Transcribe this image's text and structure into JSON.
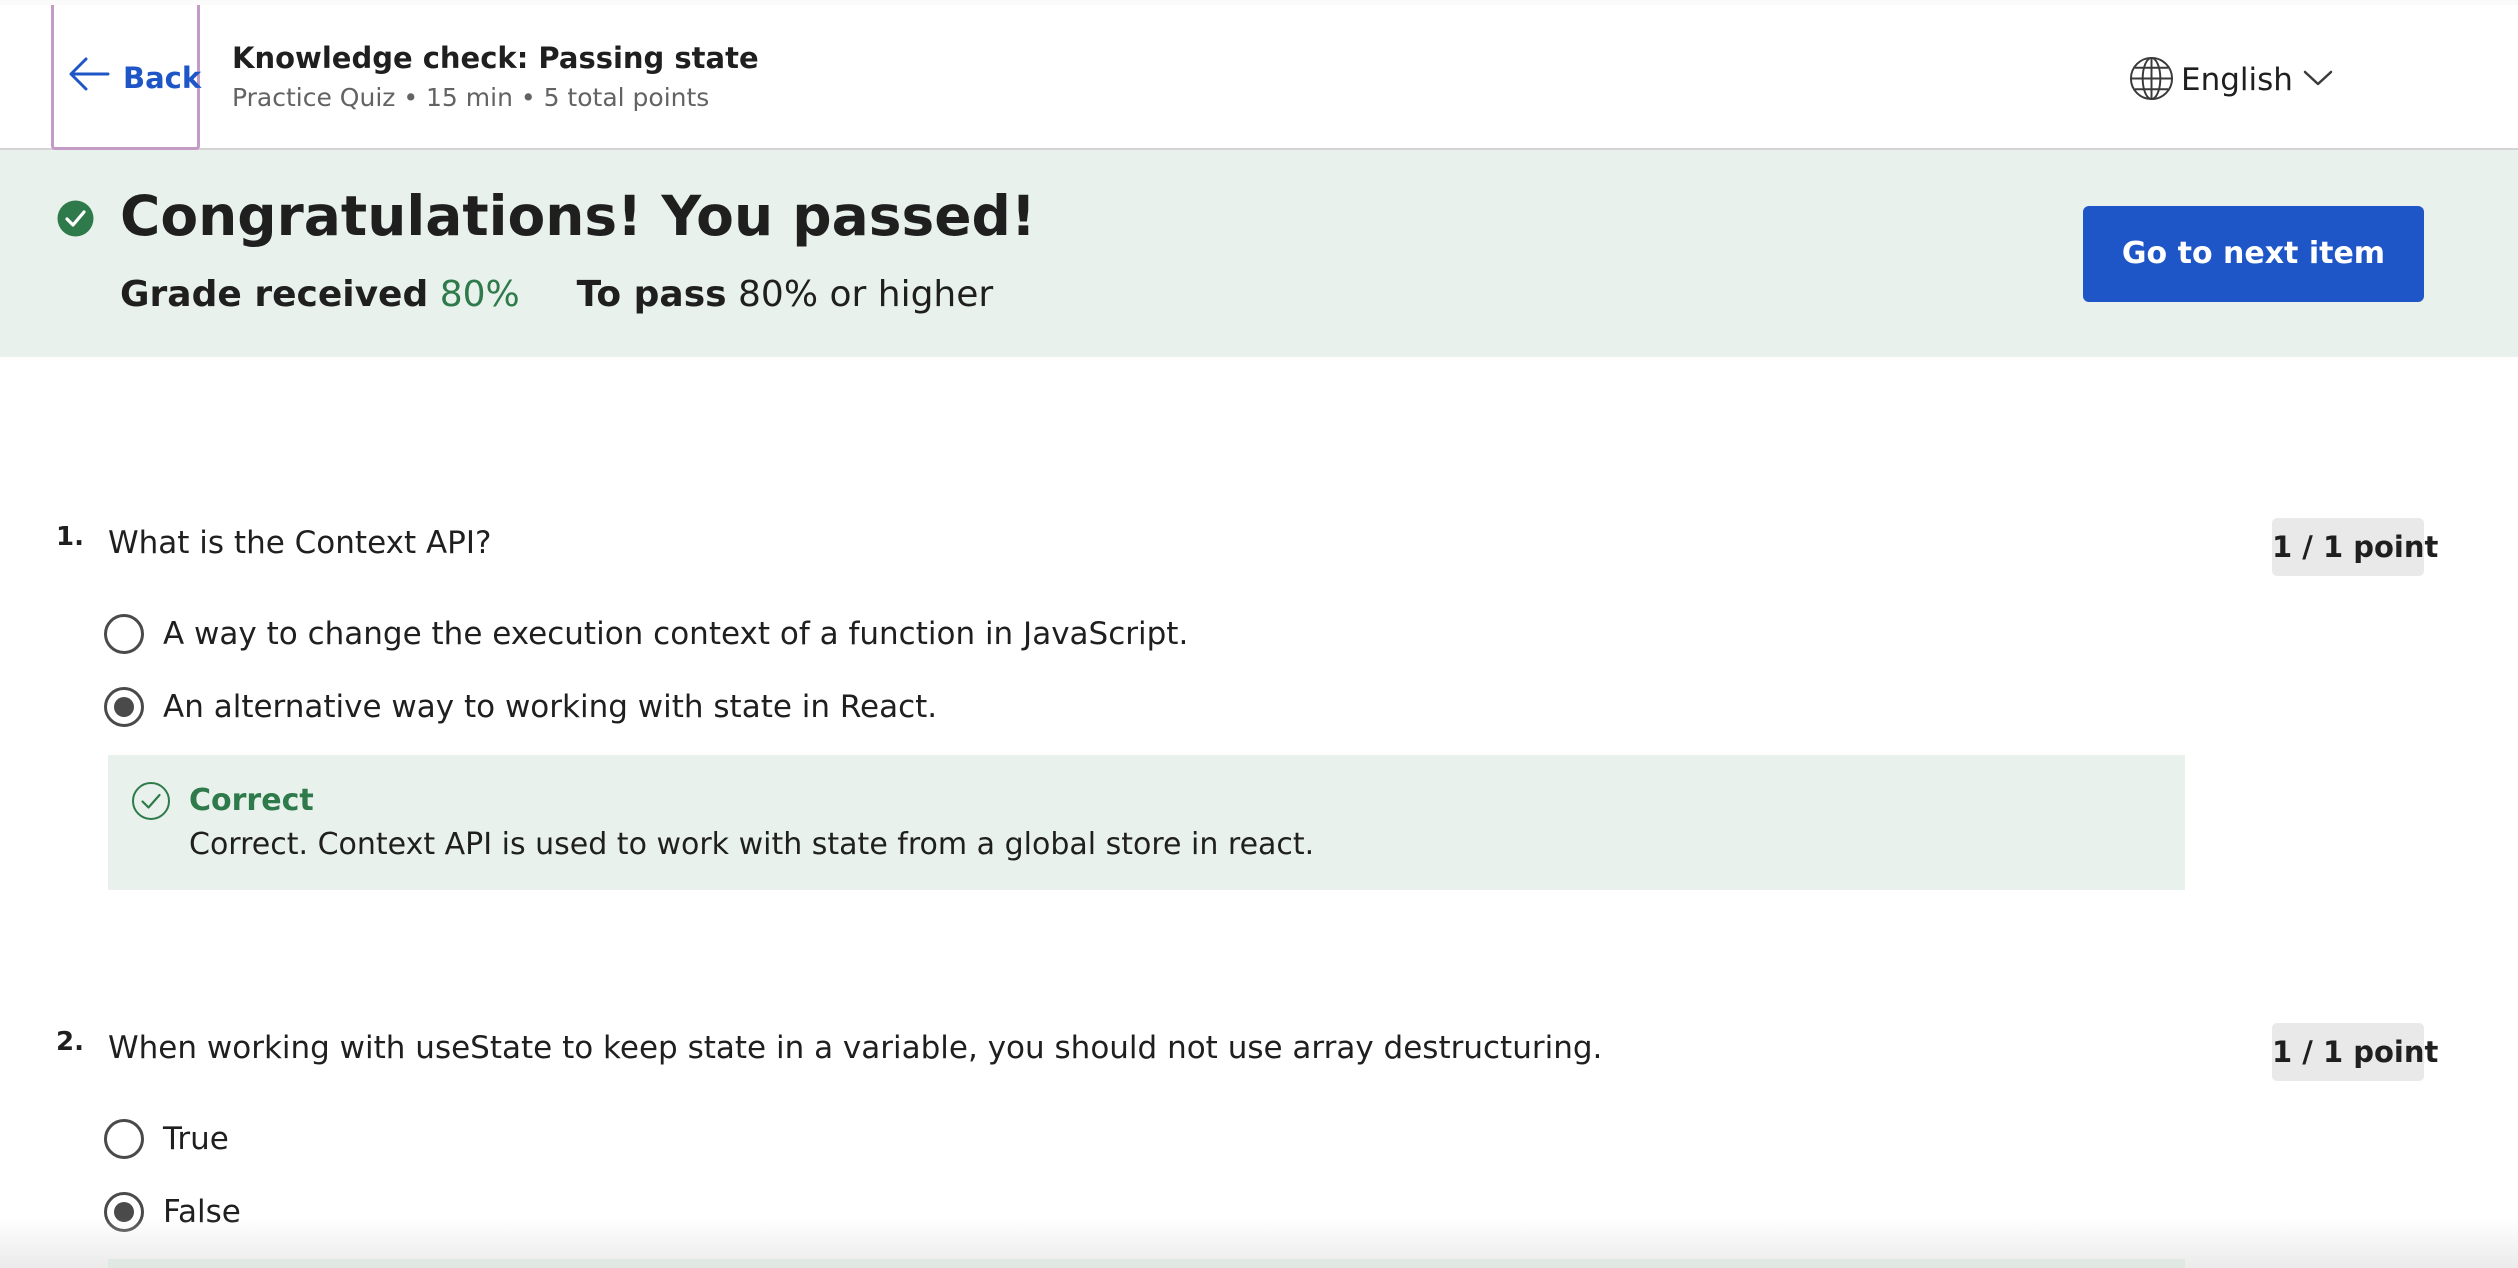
{
  "header": {
    "back_label": "Back",
    "title": "Knowledge check: Passing state",
    "meta": "Practice Quiz • 15 min • 5 total points",
    "language": "English"
  },
  "banner": {
    "title": "Congratulations! You passed!",
    "grade_label": "Grade received",
    "grade_value": "80%",
    "pass_label": "To pass",
    "pass_value": "80% or higher",
    "next_button": "Go to next item"
  },
  "questions": [
    {
      "number": "1.",
      "text": "What is the Context API?",
      "points": "1 / 1 point",
      "options": [
        {
          "label": "A way to change the execution context of a function in JavaScript.",
          "selected": false
        },
        {
          "label": "An alternative way to working with state in React.",
          "selected": true
        }
      ],
      "feedback": {
        "title": "Correct",
        "text": "Correct. Context API is used to work with state from a global store in react."
      }
    },
    {
      "number": "2.",
      "text": "When working with useState to keep state in a variable, you should not use array destructuring.",
      "points": "1 / 1 point",
      "options": [
        {
          "label": "True",
          "selected": false
        },
        {
          "label": "False",
          "selected": true
        }
      ]
    }
  ],
  "colors": {
    "accent": "#1e55c7",
    "success": "#2f7a4b",
    "banner_bg": "#e8f1ec",
    "focus_outline": "#c49ac6"
  },
  "icons": {
    "back": "arrow-left-icon",
    "language": "globe-icon",
    "dropdown": "chevron-down-icon",
    "passed": "check-circle-filled-icon",
    "correct": "check-circle-outline-icon"
  }
}
